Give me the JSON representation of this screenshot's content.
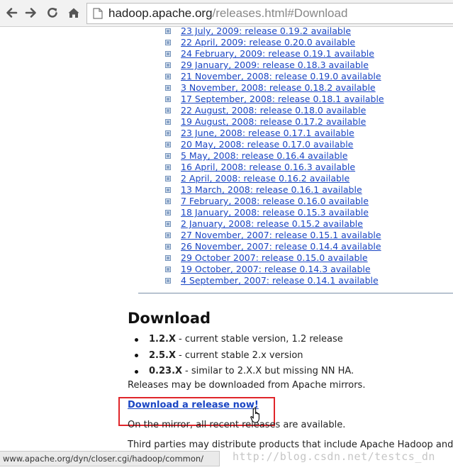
{
  "browser": {
    "url_host": "hadoop.apache.org",
    "url_path": "/releases.html#Download",
    "icons": [
      "back-arrow-icon",
      "forward-arrow-icon",
      "reload-icon",
      "home-icon",
      "page-icon"
    ]
  },
  "releases": [
    "23 July, 2009: release 0.19.2 available",
    "22 April, 2009: release 0.20.0 available",
    "24 February, 2009: release 0.19.1 available",
    "29 January, 2009: release 0.18.3 available",
    "21 November, 2008: release 0.19.0 available",
    "3 November, 2008: release 0.18.2 available",
    "17 September, 2008: release 0.18.1 available",
    "22 August, 2008: release 0.18.0 available",
    "19 August, 2008: release 0.17.2 available",
    "23 June, 2008: release 0.17.1 available",
    "20 May, 2008: release 0.17.0 available",
    "5 May, 2008: release 0.16.4 available",
    "16 April, 2008: release 0.16.3 available",
    "2 April, 2008: release 0.16.2 available",
    "13 March, 2008: release 0.16.1 available",
    "7 February, 2008: release 0.16.0 available",
    "18 January, 2008: release 0.15.3 available",
    "2 January, 2008: release 0.15.2 available",
    "27 November, 2007: release 0.15.1 available",
    "26 November, 2007: release 0.14.4 available",
    "29 October 2007: release 0.15.0 available",
    "19 October, 2007: release 0.14.3 available",
    "4 September, 2007: release 0.14.1 available"
  ],
  "download": {
    "heading": "Download",
    "versions": [
      {
        "name": "1.2.X",
        "desc": "- current stable version, 1.2 release"
      },
      {
        "name": "2.5.X",
        "desc": "- current stable 2.x version"
      },
      {
        "name": "0.23.X",
        "desc": "- similar to 2.X.X but missing NN HA."
      }
    ],
    "mirrors_text": "Releases may be downloaded from Apache mirrors.",
    "link_label": "Download a release now!",
    "mirror_note": "On the mirror, all recent releases are available.",
    "third_party_text": "Third parties may distribute products that include Apache Hadoop and d"
  },
  "status_bar": {
    "url": "www.apache.org/dyn/closer.cgi/hadoop/common/"
  },
  "watermark": "http://blog.csdn.net/testcs_dn",
  "colors": {
    "link": "#1a46c4",
    "highlight_box": "#e0252a"
  }
}
